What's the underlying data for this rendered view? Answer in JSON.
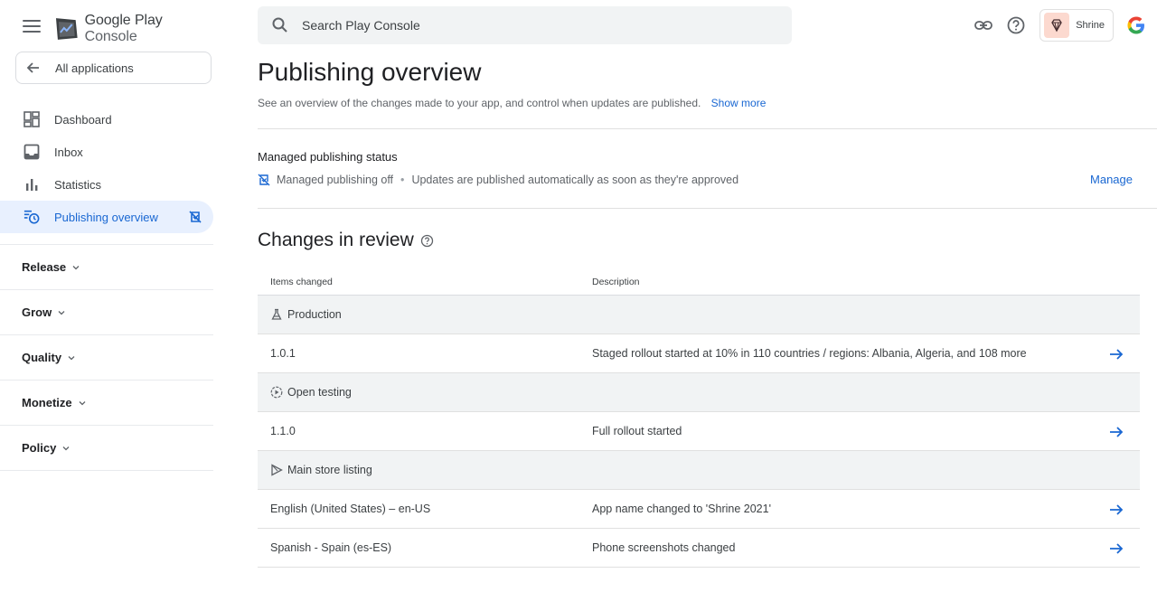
{
  "app": {
    "logo_text_primary": "Google Play",
    "logo_text_secondary": "Console"
  },
  "sidebar": {
    "all_apps_label": "All applications",
    "items": [
      {
        "label": "Dashboard",
        "icon": "dashboard-icon"
      },
      {
        "label": "Inbox",
        "icon": "inbox-icon"
      },
      {
        "label": "Statistics",
        "icon": "statistics-icon"
      },
      {
        "label": "Publishing overview",
        "icon": "publishing-overview-icon",
        "active": true
      }
    ],
    "sections": [
      {
        "label": "Release"
      },
      {
        "label": "Grow"
      },
      {
        "label": "Quality"
      },
      {
        "label": "Monetize"
      },
      {
        "label": "Policy"
      }
    ]
  },
  "search": {
    "placeholder": "Search Play Console"
  },
  "header": {
    "app_name": "Shrine"
  },
  "main": {
    "title": "Publishing overview",
    "description": "See an overview of the changes made to your app, and control when updates are published.",
    "show_more": "Show more",
    "managed_publishing": {
      "title": "Managed publishing status",
      "status": "Managed publishing off",
      "separator": "•",
      "status_detail": "Updates are published automatically as soon as they're approved",
      "manage_label": "Manage"
    },
    "changes_in_review": {
      "title": "Changes in review",
      "columns": [
        "Items changed",
        "Description"
      ],
      "groups": [
        {
          "name": "Production",
          "icon": "production-icon",
          "rows": [
            {
              "item": "1.0.1",
              "description": "Staged rollout started at 10% in 110 countries / regions: Albania, Algeria, and 108 more"
            }
          ]
        },
        {
          "name": "Open testing",
          "icon": "open-testing-icon",
          "rows": [
            {
              "item": "1.1.0",
              "description": "Full rollout started"
            }
          ]
        },
        {
          "name": "Main store listing",
          "icon": "store-listing-icon",
          "rows": [
            {
              "item": "English (United States) – en-US",
              "description": "App name changed to 'Shrine 2021'"
            },
            {
              "item": "Spanish - Spain (es-ES)",
              "description": "Phone screenshots changed"
            }
          ]
        }
      ]
    }
  },
  "colors": {
    "accent": "#1967d2",
    "active_bg": "#e8f0fe",
    "group_bg": "#f1f3f4"
  }
}
